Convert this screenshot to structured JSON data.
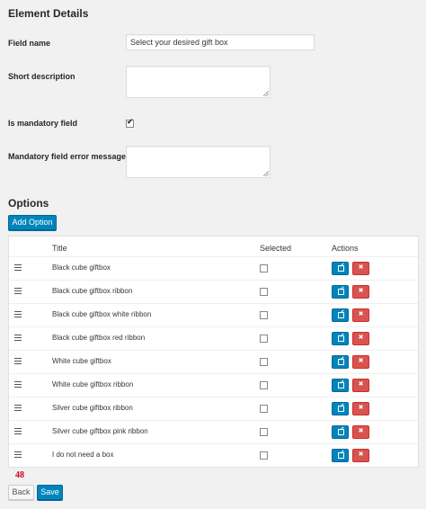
{
  "element_details": {
    "heading": "Element Details",
    "field_name_label": "Field name",
    "field_name_value": "Select your desired gift box",
    "short_description_label": "Short description",
    "mandatory_label": "Is mandatory field",
    "mandatory_checked": true,
    "error_message_label": "Mandatory field error message"
  },
  "options": {
    "heading": "Options",
    "add_button": "Add Option",
    "columns": {
      "title": "Title",
      "selected": "Selected",
      "actions": "Actions"
    },
    "rows": [
      {
        "title": "Black cube giftbox",
        "selected": false
      },
      {
        "title": "Black cube giftbox ribbon",
        "selected": false
      },
      {
        "title": "Black cube giftbox white ribbon",
        "selected": false
      },
      {
        "title": "Black cube giftbox red ribbon",
        "selected": false
      },
      {
        "title": "White cube giftbox",
        "selected": false
      },
      {
        "title": "White cube giftbox ribbon",
        "selected": false
      },
      {
        "title": "Silver cube giftbox ribbon",
        "selected": false
      },
      {
        "title": "Silver cube giftbox pink ribbon",
        "selected": false
      },
      {
        "title": "I do not need a box",
        "selected": false
      }
    ]
  },
  "footer": {
    "page_number": "48",
    "back_button": "Back",
    "save_button": "Save"
  },
  "icons": {
    "drag": "drag-handle-icon",
    "edit": "edit-icon",
    "delete": "delete-icon"
  },
  "colors": {
    "primary": "#0085ba",
    "danger": "#d9534f",
    "page_number": "#d0021b"
  }
}
